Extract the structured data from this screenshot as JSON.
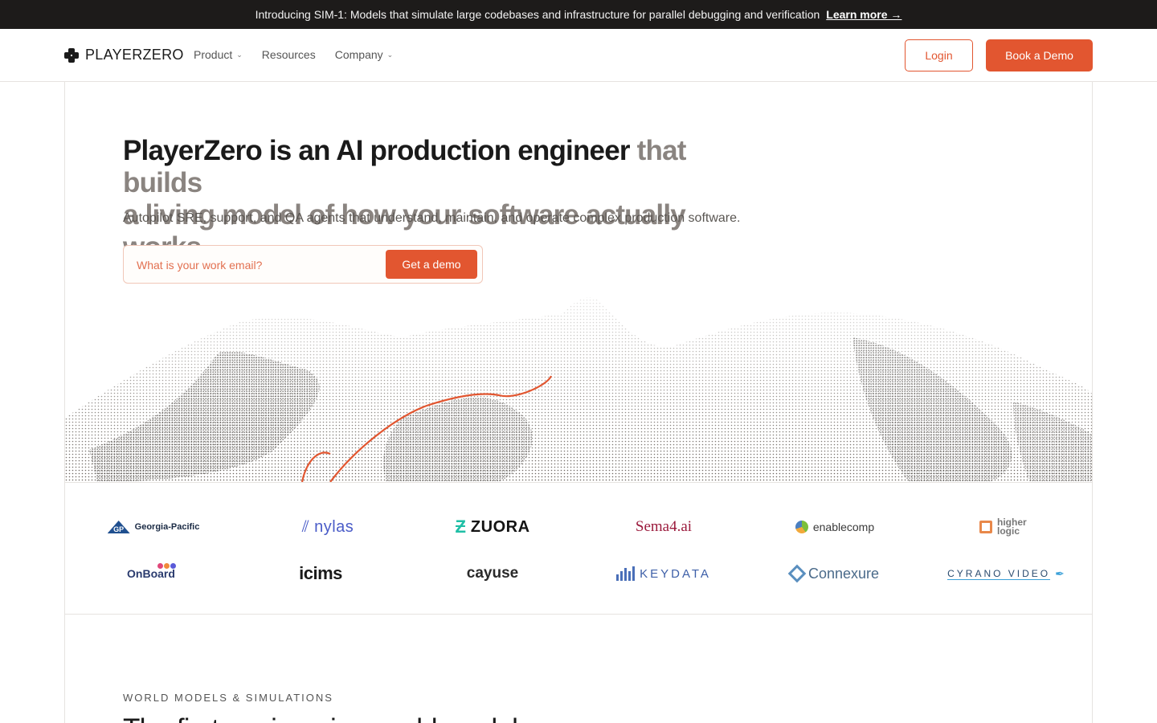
{
  "announcement": {
    "text": "Introducing SIM-1: Models that simulate large codebases and infrastructure for parallel debugging and verification",
    "link": "Learn more →"
  },
  "nav": {
    "brand": "PLAYERZERO",
    "items": [
      {
        "label": "Product",
        "has_dropdown": true
      },
      {
        "label": "Resources",
        "has_dropdown": false
      },
      {
        "label": "Company",
        "has_dropdown": true
      }
    ],
    "login": "Login",
    "book_demo": "Book a Demo"
  },
  "hero": {
    "title_strong": "PlayerZero is an AI production engineer",
    "title_muted_1": " that builds",
    "title_muted_2": "a living model of how your software actually works.",
    "subtitle": "Autopilot SRE, support, and QA agents that understand, maintain, and operate complex production software.",
    "email_placeholder": "What is your work email?",
    "email_button": "Get a demo"
  },
  "logos": {
    "row1": [
      "Georgia-Pacific",
      "nylas",
      "ZUORA",
      "Sema4.ai",
      "enablecomp",
      "higher logic"
    ],
    "row2": [
      "OnBoard",
      "icims",
      "cayuse",
      "KEYDATA",
      "Connexure",
      "CYRANO VIDEO"
    ]
  },
  "section": {
    "eyebrow": "WORLD MODELS & SIMULATIONS",
    "title": "The first engineering world model"
  },
  "colors": {
    "accent": "#e25630",
    "announce_bg": "#1d1b1a",
    "muted_text": "#8a8480"
  }
}
